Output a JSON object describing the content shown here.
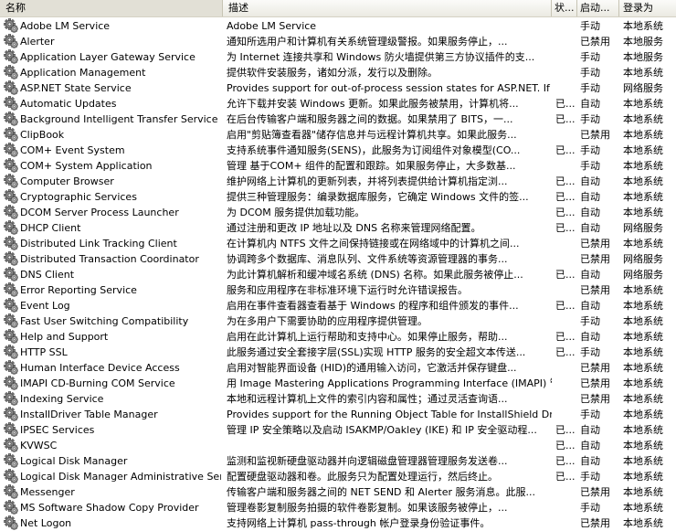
{
  "columns": {
    "name": "名称",
    "sort_indicator": "▲",
    "description": "描述",
    "status": "状...",
    "startup": "启动...",
    "logon": "登录为"
  },
  "services": [
    {
      "name": "Adobe LM Service",
      "description": "Adobe LM Service",
      "status": "",
      "startup": "手动",
      "logon": "本地系统"
    },
    {
      "name": "Alerter",
      "description": "通知所选用户和计算机有关系统管理级警报。如果服务停止，...",
      "status": "",
      "startup": "已禁用",
      "logon": "本地服务"
    },
    {
      "name": "Application Layer Gateway Service",
      "description": "为 Internet 连接共享和 Windows 防火墙提供第三方协议插件的支...",
      "status": "",
      "startup": "手动",
      "logon": "本地服务"
    },
    {
      "name": "Application Management",
      "description": "提供软件安装服务，诸如分派，发行以及删除。",
      "status": "",
      "startup": "手动",
      "logon": "本地系统"
    },
    {
      "name": "ASP.NET State Service",
      "description": "Provides support for out-of-process session states for ASP.NET. If thi...",
      "status": "",
      "startup": "手动",
      "logon": "网络服务"
    },
    {
      "name": "Automatic Updates",
      "description": "允许下载并安装 Windows 更新。如果此服务被禁用，计算机将...",
      "status": "已...",
      "startup": "自动",
      "logon": "本地系统"
    },
    {
      "name": "Background Intelligent Transfer Service",
      "description": "在后台传输客户端和服务器之间的数据。如果禁用了 BITS，一...",
      "status": "已...",
      "startup": "手动",
      "logon": "本地系统"
    },
    {
      "name": "ClipBook",
      "description": "启用\"剪贴簿查看器\"储存信息并与远程计算机共享。如果此服务...",
      "status": "",
      "startup": "已禁用",
      "logon": "本地系统"
    },
    {
      "name": "COM+ Event System",
      "description": "支持系统事件通知服务(SENS)，此服务为订阅组件对象模型(CO...",
      "status": "已...",
      "startup": "手动",
      "logon": "本地系统"
    },
    {
      "name": "COM+ System Application",
      "description": "管理 基于COM+ 组件的配置和跟踪。如果服务停止，大多数基...",
      "status": "",
      "startup": "手动",
      "logon": "本地系统"
    },
    {
      "name": "Computer Browser",
      "description": "维护网络上计算机的更新列表，并将列表提供给计算机指定浏...",
      "status": "已...",
      "startup": "自动",
      "logon": "本地系统"
    },
    {
      "name": "Cryptographic Services",
      "description": "提供三种管理服务：编录数据库服务，它确定 Windows 文件的签...",
      "status": "已...",
      "startup": "自动",
      "logon": "本地系统"
    },
    {
      "name": "DCOM Server Process Launcher",
      "description": "为 DCOM 服务提供加载功能。",
      "status": "已...",
      "startup": "自动",
      "logon": "本地系统"
    },
    {
      "name": "DHCP Client",
      "description": "通过注册和更改 IP 地址以及 DNS 名称来管理网络配置。",
      "status": "已...",
      "startup": "自动",
      "logon": "网络服务"
    },
    {
      "name": "Distributed Link Tracking Client",
      "description": "在计算机内 NTFS 文件之间保持链接或在网络域中的计算机之间...",
      "status": "",
      "startup": "已禁用",
      "logon": "本地系统"
    },
    {
      "name": "Distributed Transaction Coordinator",
      "description": "协调跨多个数据库、消息队列、文件系统等资源管理器的事务...",
      "status": "",
      "startup": "已禁用",
      "logon": "网络服务"
    },
    {
      "name": "DNS Client",
      "description": "为此计算机解析和缓冲域名系统 (DNS) 名称。如果此服务被停止...",
      "status": "已...",
      "startup": "自动",
      "logon": "网络服务"
    },
    {
      "name": "Error Reporting Service",
      "description": "服务和应用程序在非标准环境下运行时允许错误报告。",
      "status": "",
      "startup": "已禁用",
      "logon": "本地系统"
    },
    {
      "name": "Event Log",
      "description": "启用在事件查看器查看基于 Windows 的程序和组件颁发的事件...",
      "status": "已...",
      "startup": "自动",
      "logon": "本地系统"
    },
    {
      "name": "Fast User Switching Compatibility",
      "description": "为在多用户下需要协助的应用程序提供管理。",
      "status": "",
      "startup": "手动",
      "logon": "本地系统"
    },
    {
      "name": "Help and Support",
      "description": "启用在此计算机上运行帮助和支持中心。如果停止服务，帮助...",
      "status": "已...",
      "startup": "自动",
      "logon": "本地系统"
    },
    {
      "name": "HTTP SSL",
      "description": "此服务通过安全套接字层(SSL)实现 HTTP 服务的安全超文本传送...",
      "status": "已...",
      "startup": "手动",
      "logon": "本地系统"
    },
    {
      "name": "Human Interface Device Access",
      "description": "启用对智能界面设备 (HID)的通用输入访问，它激活并保存键盘...",
      "status": "",
      "startup": "已禁用",
      "logon": "本地系统"
    },
    {
      "name": "IMAPI CD-Burning COM Service",
      "description": "用 Image Mastering Applications Programming Interface (IMAPI) 管理...",
      "status": "",
      "startup": "已禁用",
      "logon": "本地系统"
    },
    {
      "name": "Indexing Service",
      "description": "本地和远程计算机上文件的索引内容和属性；通过灵活查询语...",
      "status": "",
      "startup": "已禁用",
      "logon": "本地系统"
    },
    {
      "name": "InstallDriver Table Manager",
      "description": "Provides support for the Running Object Table for InstallShield Drivers",
      "status": "",
      "startup": "手动",
      "logon": "本地系统"
    },
    {
      "name": "IPSEC Services",
      "description": "管理 IP 安全策略以及启动 ISAKMP/Oakley (IKE) 和 IP 安全驱动程...",
      "status": "已...",
      "startup": "自动",
      "logon": "本地系统"
    },
    {
      "name": "KVWSC",
      "description": "",
      "status": "已...",
      "startup": "自动",
      "logon": "本地系统"
    },
    {
      "name": "Logical Disk Manager",
      "description": "监测和监视新硬盘驱动器并向逻辑磁盘管理器管理服务发送卷...",
      "status": "已...",
      "startup": "自动",
      "logon": "本地系统"
    },
    {
      "name": "Logical Disk Manager Administrative Service",
      "description": "配置硬盘驱动器和卷。此服务只为配置处理运行，然后终止。",
      "status": "已...",
      "startup": "手动",
      "logon": "本地系统"
    },
    {
      "name": "Messenger",
      "description": "传输客户端和服务器之间的 NET SEND 和 Alerter 服务消息。此服...",
      "status": "",
      "startup": "已禁用",
      "logon": "本地系统"
    },
    {
      "name": "MS Software Shadow Copy Provider",
      "description": "管理卷影复制服务拍摄的软件卷影复制。如果该服务被停止，...",
      "status": "",
      "startup": "手动",
      "logon": "本地系统"
    },
    {
      "name": "Net Logon",
      "description": "支持网络上计算机 pass-through 帐户登录身份验证事件。",
      "status": "",
      "startup": "已禁用",
      "logon": "本地系统"
    }
  ],
  "icon": "gear-icon"
}
